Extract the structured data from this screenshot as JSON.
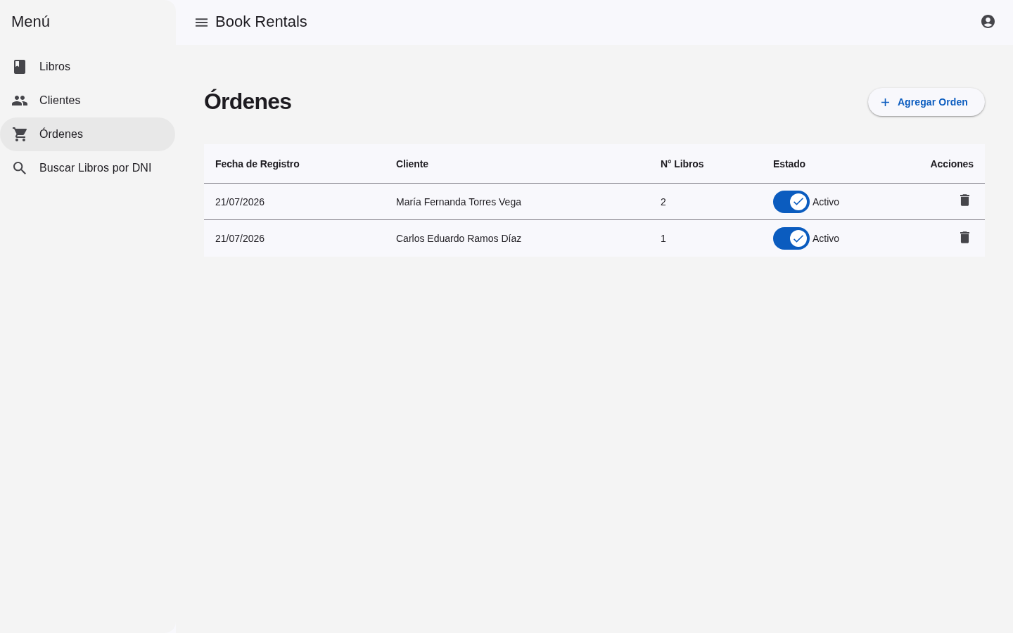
{
  "sidebar": {
    "title": "Menú",
    "items": [
      {
        "label": "Libros",
        "selected": false
      },
      {
        "label": "Clientes",
        "selected": false
      },
      {
        "label": "Órdenes",
        "selected": true
      },
      {
        "label": "Buscar Libros por DNI",
        "selected": false
      }
    ]
  },
  "top_bar": {
    "title": "Book Rentals"
  },
  "page": {
    "title": "Órdenes",
    "add_button": "Agregar Orden"
  },
  "table": {
    "columns": [
      "Fecha de Registro",
      "Cliente",
      "N° Libros",
      "Estado",
      "Acciones"
    ],
    "rows": [
      {
        "date": "21/07/2026",
        "client": "María Fernanda Torres Vega",
        "books": "2",
        "active": true,
        "status": "Activo"
      },
      {
        "date": "21/07/2026",
        "client": "Carlos Eduardo Ramos Díaz",
        "books": "1",
        "active": true,
        "status": "Activo"
      }
    ]
  }
}
